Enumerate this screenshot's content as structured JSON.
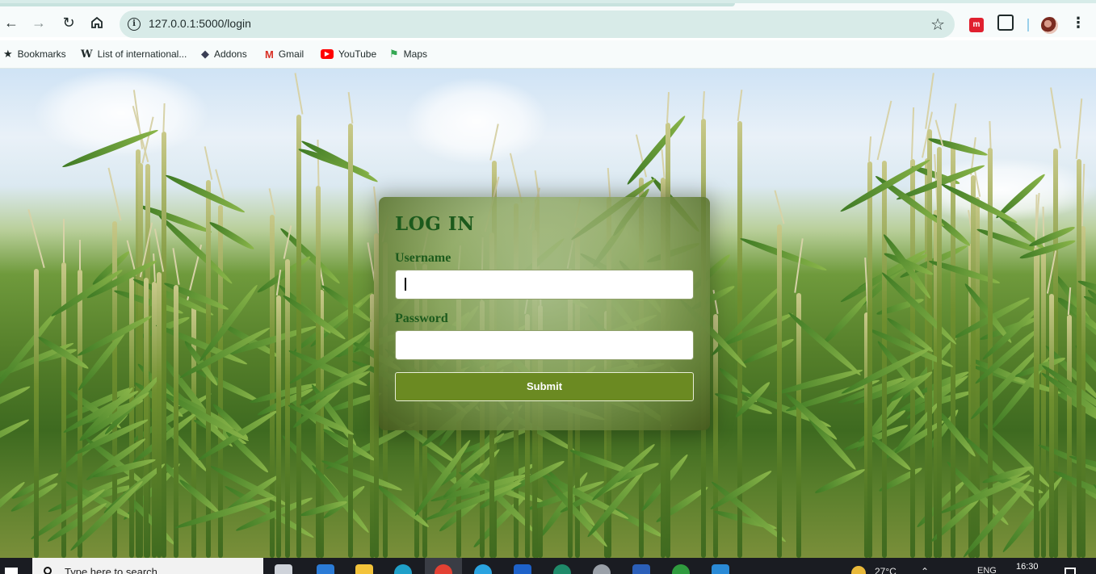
{
  "browser": {
    "url": "127.0.0.1:5000/login",
    "bookmarks": [
      {
        "label": "Bookmarks",
        "icon": "star-icon"
      },
      {
        "label": "List of international...",
        "icon": "wikipedia-icon"
      },
      {
        "label": "Addons",
        "icon": "addons-icon"
      },
      {
        "label": "Gmail",
        "icon": "gmail-icon"
      },
      {
        "label": "YouTube",
        "icon": "youtube-icon"
      },
      {
        "label": "Maps",
        "icon": "maps-icon"
      }
    ]
  },
  "login": {
    "title": "LOG IN",
    "username_label": "Username",
    "username_value": "",
    "password_label": "Password",
    "password_value": "",
    "submit_label": "Submit"
  },
  "taskbar": {
    "search_placeholder": "Type here to search",
    "temperature": "27°C",
    "language": "ENG",
    "time": "16:30"
  },
  "colors": {
    "title_green": "#1c5a1c",
    "submit_bg": "#6b8a22",
    "omnibox_bg": "#d8ebe8"
  }
}
